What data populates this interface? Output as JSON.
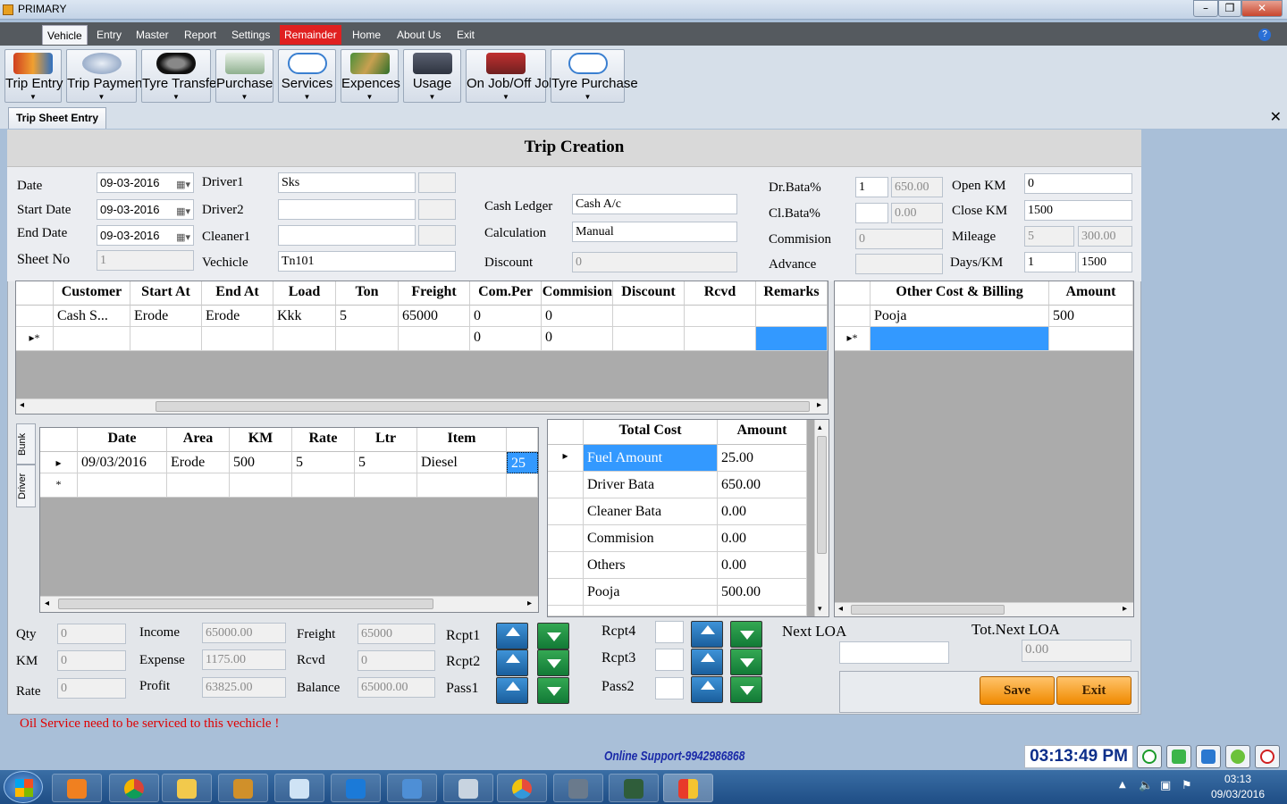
{
  "window": {
    "title": "PRIMARY",
    "controls": [
      "minimize",
      "maximize",
      "close"
    ]
  },
  "menu": [
    {
      "label": "Vehicle",
      "active": true
    },
    {
      "label": "Entry"
    },
    {
      "label": "Master"
    },
    {
      "label": "Report"
    },
    {
      "label": "Settings"
    },
    {
      "label": "Remainder",
      "highlight": true
    },
    {
      "label": "Home"
    },
    {
      "label": "About Us"
    },
    {
      "label": "Exit"
    }
  ],
  "toolbar": [
    {
      "label": "Trip Entry",
      "icon": "truck-icon"
    },
    {
      "label": "Trip Payment",
      "icon": "money-icon"
    },
    {
      "label": "Tyre Transfer",
      "icon": "tyre-icon"
    },
    {
      "label": "Purchase",
      "icon": "purchase-icon"
    },
    {
      "label": "Services",
      "icon": "home-icon"
    },
    {
      "label": "Expences",
      "icon": "cash-icon"
    },
    {
      "label": "Usage",
      "icon": "usage-icon"
    },
    {
      "label": "On Job/Off Job",
      "icon": "person-icon"
    },
    {
      "label": "Tyre Purchase",
      "icon": "home-icon"
    }
  ],
  "doc_tab": "Trip Sheet Entry",
  "form_title": "Trip Creation",
  "form": {
    "date_label": "Date",
    "date": "09-03-2016",
    "start_date_label": "Start Date",
    "start_date": "09-03-2016",
    "end_date_label": "End Date",
    "end_date": "09-03-2016",
    "sheet_no_label": "Sheet No",
    "sheet_no": "1",
    "driver1_label": "Driver1",
    "driver1": "Sks",
    "driver2_label": "Driver2",
    "driver2": "",
    "cleaner1_label": "Cleaner1",
    "cleaner1": "",
    "vehicle_label": "Vechicle",
    "vehicle": "Tn101",
    "cash_ledger_label": "Cash Ledger",
    "cash_ledger": "Cash A/c",
    "calculation_label": "Calculation",
    "calculation": "Manual",
    "discount_label": "Discount",
    "discount": "0",
    "dr_bata_label": "Dr.Bata%",
    "dr_bata": "1",
    "dr_bata_amt": "650.00",
    "cl_bata_label": "Cl.Bata%",
    "cl_bata": "",
    "cl_bata_amt": "0.00",
    "commision_label": "Commision",
    "commision": "0",
    "advance_label": "Advance",
    "advance": "",
    "open_km_label": "Open KM",
    "open_km": "0",
    "close_km_label": "Close KM",
    "close_km": "1500",
    "mileage_label": "Mileage",
    "mileage": "5",
    "mileage_val": "300.00",
    "days_km_label": "Days/KM",
    "days": "1",
    "km": "1500"
  },
  "trip_grid": {
    "headers": [
      "Customer",
      "Start At",
      "End At",
      "Load",
      "Ton",
      "Freight",
      "Com.Per",
      "Commision",
      "Discount",
      "Rcvd",
      "Remarks"
    ],
    "rows": [
      [
        "Cash S...",
        "Erode",
        "Erode",
        "Kkk",
        "5",
        "65000",
        "0",
        "0",
        "",
        "",
        ""
      ],
      [
        "",
        "",
        "",
        "",
        "",
        "",
        "0",
        "0",
        "",
        "",
        ""
      ]
    ]
  },
  "other_grid": {
    "headers": [
      "Other Cost & Billing",
      "Amount"
    ],
    "rows": [
      [
        "Pooja",
        "500"
      ],
      [
        "",
        ""
      ]
    ]
  },
  "side_tabs": [
    "Bunk",
    "Driver"
  ],
  "bunk_grid": {
    "headers": [
      "Date",
      "Area",
      "KM",
      "Rate",
      "Ltr",
      "Item",
      ""
    ],
    "rows": [
      [
        "09/03/2016",
        "Erode",
        "500",
        "5",
        "5",
        "Diesel",
        "25"
      ],
      [
        "",
        "",
        "",
        "",
        "",
        "",
        ""
      ]
    ]
  },
  "cost_grid": {
    "headers": [
      "Total Cost",
      "Amount"
    ],
    "rows": [
      [
        "Fuel Amount",
        "25.00"
      ],
      [
        "Driver Bata",
        "650.00"
      ],
      [
        "Cleaner Bata",
        "0.00"
      ],
      [
        "Commision",
        "0.00"
      ],
      [
        "Others",
        "0.00"
      ],
      [
        "Pooja",
        "500.00"
      ]
    ]
  },
  "summary": {
    "qty_label": "Qty",
    "qty": "0",
    "km_label": "KM",
    "km": "0",
    "rate_label": "Rate",
    "rate": "0",
    "income_label": "Income",
    "income": "65000.00",
    "expense_label": "Expense",
    "expense": "1175.00",
    "profit_label": "Profit",
    "profit": "63825.00",
    "freight_label": "Freight",
    "freight": "65000",
    "rcvd_label": "Rcvd",
    "rcvd": "0",
    "balance_label": "Balance",
    "balance": "65000.00",
    "rcpt1_label": "Rcpt1",
    "rcpt2_label": "Rcpt2",
    "pass1_label": "Pass1",
    "rcpt4_label": "Rcpt4",
    "rcpt3_label": "Rcpt3",
    "pass2_label": "Pass2",
    "next_loa_label": "Next LOA",
    "next_loa": "",
    "tot_next_loa_label": "Tot.Next LOA",
    "tot_next_loa": "0.00",
    "save_label": "Save",
    "exit_label": "Exit"
  },
  "alert": "Oil Service need to be serviced to this vechicle !",
  "support": "Online Support-9942986868",
  "clock": "03:13:49 PM",
  "taskbar": {
    "time": "03:13",
    "date": "09/03/2016"
  },
  "colors": {
    "accent_red": "#e02020",
    "selection": "#3399ff",
    "button_orange": "#f08a00",
    "alert": "#e00000",
    "support_blue": "#1a2aa8"
  }
}
